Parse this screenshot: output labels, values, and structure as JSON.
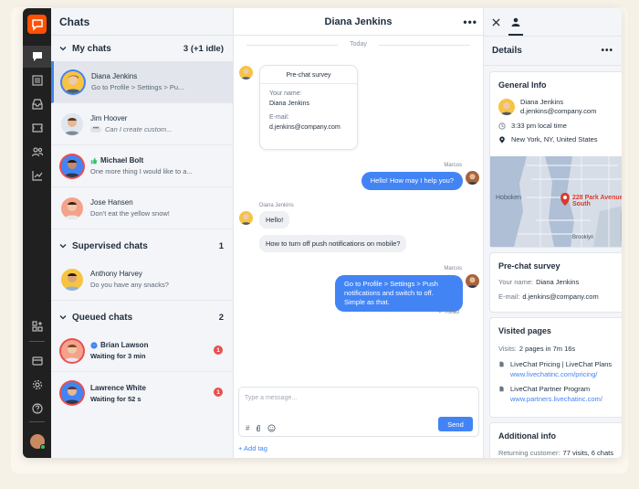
{
  "colors": {
    "brand": "#ff5100",
    "accent": "#4384f5",
    "alert": "#e94f4f"
  },
  "rail": {
    "icons": [
      "chat-icon",
      "list-icon",
      "inbox-icon",
      "ticket-icon",
      "people-icon",
      "chart-icon",
      "apps-icon",
      "billing-icon",
      "settings-icon",
      "help-icon"
    ]
  },
  "list": {
    "title": "Chats",
    "my_chats": {
      "label": "My chats",
      "count": "3 (+1 idle)",
      "items": [
        {
          "name": "Diana Jenkins",
          "message": "Go to Profile > Settings > Pu..."
        },
        {
          "name": "Jim Hoover",
          "message": "Can I create custom..."
        },
        {
          "name": "Michael Bolt",
          "message": "One more thing I would like to a..."
        },
        {
          "name": "Jose Hansen",
          "message": "Don't eat the yellow snow!"
        }
      ]
    },
    "supervised": {
      "label": "Supervised chats",
      "count": "1",
      "items": [
        {
          "name": "Anthony Harvey",
          "message": "Do you have any snacks?"
        }
      ]
    },
    "queued": {
      "label": "Queued chats",
      "count": "2",
      "items": [
        {
          "name": "Brian Lawson",
          "message": "Waiting for 3 min",
          "badge": "1"
        },
        {
          "name": "Lawrence White",
          "message": "Waiting for 52 s",
          "badge": "1"
        }
      ]
    }
  },
  "chat": {
    "title": "Diana Jenkins",
    "day": "Today",
    "survey": {
      "title": "Pre-chat survey",
      "name_label": "Your name:",
      "name_value": "Diana Jenkins",
      "email_label": "E-mail:",
      "email_value": "d.jenkins@company.com"
    },
    "messages": [
      {
        "sender": "Marcos",
        "text": "Hello! How may I help you?"
      },
      {
        "sender": "Diana Jenkins",
        "text": "Hello!"
      },
      {
        "text": "How to turn off push notifications on mobile?"
      },
      {
        "sender": "Marcos",
        "text": "Go to Profile > Settings > Push notifications and switch to off. Simple as that."
      }
    ],
    "read_label": "✓ Read",
    "composer_placeholder": "Type a message...",
    "send_label": "Send",
    "add_tag": "+ Add tag"
  },
  "details": {
    "title": "Details",
    "general": {
      "title": "General Info",
      "name": "Diana Jenkins",
      "email": "d.jenkins@company.com",
      "local_time": "3:33 pm local time",
      "location": "New York, NY, United States",
      "map_label": "228 Park Avenue South",
      "map_places": [
        "Brooklyn",
        "Hoboken"
      ]
    },
    "prechat": {
      "title": "Pre-chat survey",
      "name_label": "Your name:",
      "name_value": "Diana Jenkins",
      "email_label": "E-mail:",
      "email_value": "d.jenkins@company.com"
    },
    "visited": {
      "title": "Visited pages",
      "visits_label": "Visits:",
      "visits_value": "2 pages in 7m 16s",
      "pages": [
        {
          "title": "LiveChat Pricing | LiveChat Plans",
          "url": "www.livechatinc.com/pricing/"
        },
        {
          "title": "LiveChat Partner Program",
          "url": "www.partners.livechatinc.com/"
        }
      ]
    },
    "additional": {
      "title": "Additional info",
      "returning_label": "Returning customer:",
      "returning_value": "77 visits, 6 chats"
    }
  }
}
